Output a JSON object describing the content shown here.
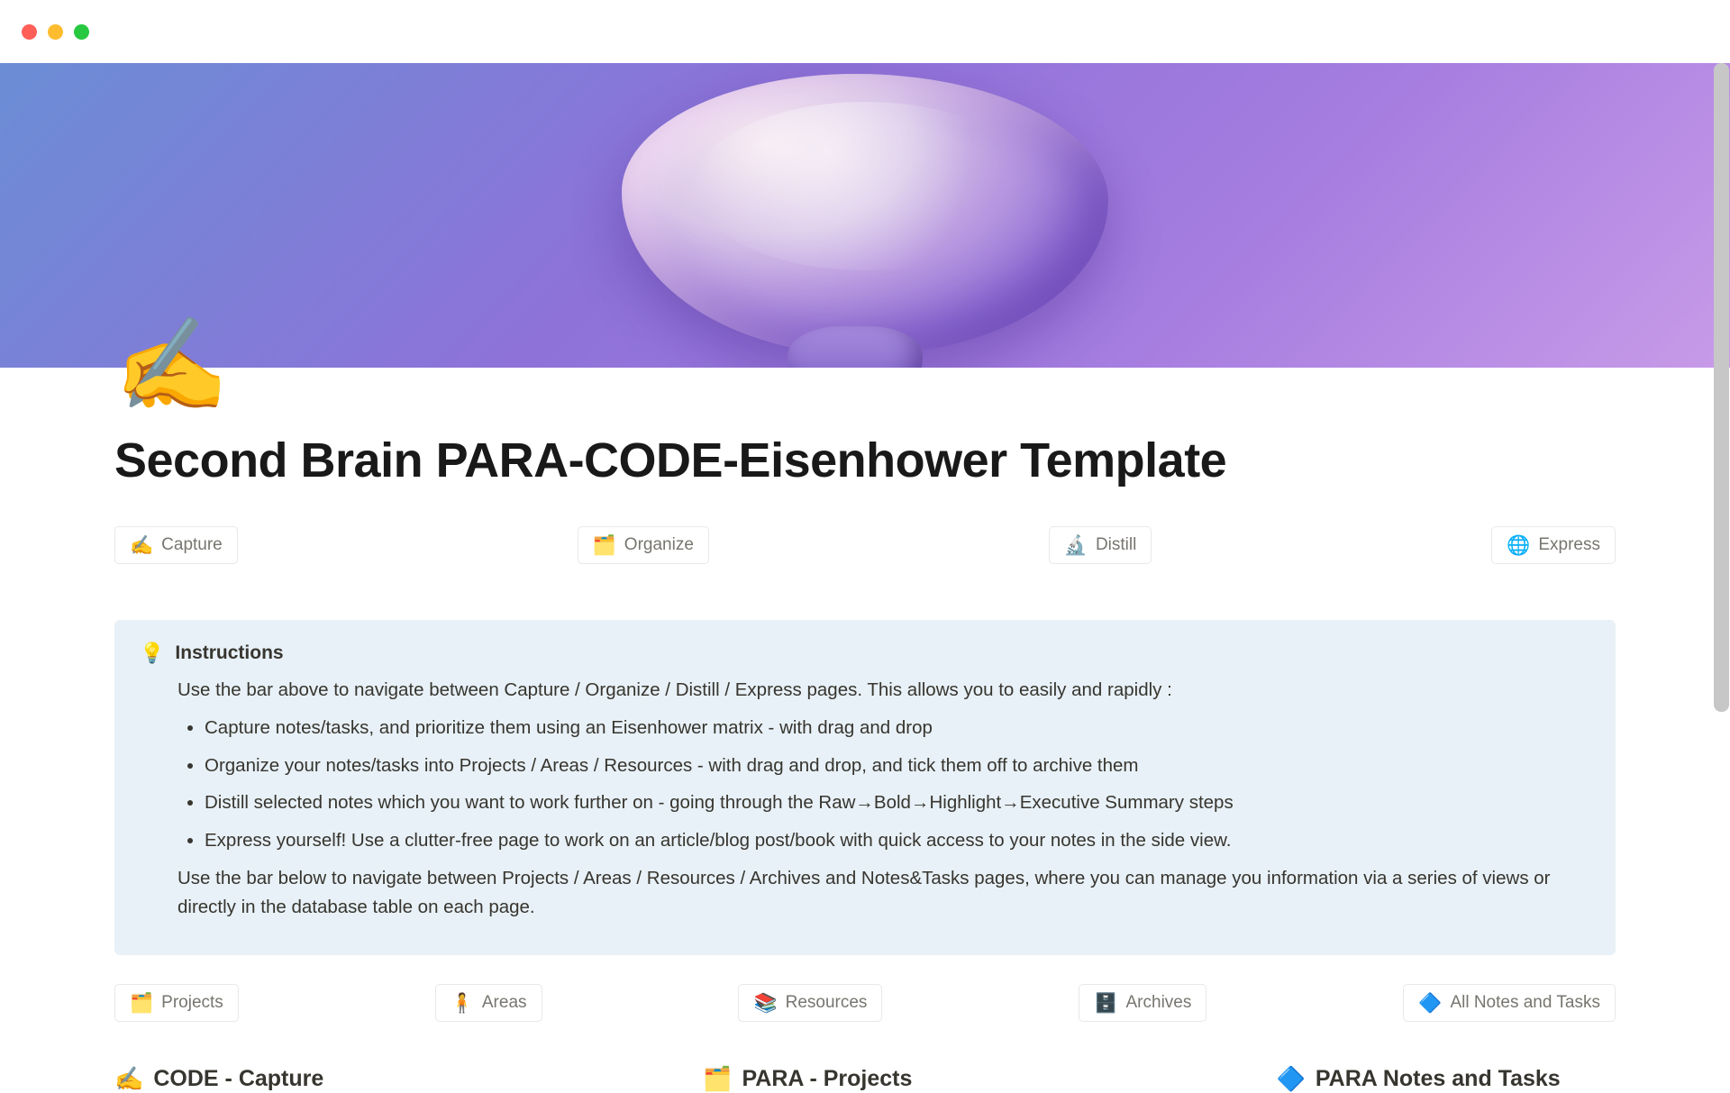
{
  "page": {
    "icon": "✍️",
    "title": "Second Brain PARA-CODE-Eisenhower Template"
  },
  "topNav": [
    {
      "emoji": "✍️",
      "label": "Capture"
    },
    {
      "emoji": "🗂️",
      "label": "Organize"
    },
    {
      "emoji": "🔬",
      "label": "Distill"
    },
    {
      "emoji": "🌐",
      "label": "Express"
    }
  ],
  "instructions": {
    "icon": "💡",
    "title": "Instructions",
    "lead": "Use the bar above to navigate between Capture / Organize / Distill / Express pages. This allows you to easily and rapidly :",
    "bullets": [
      "Capture notes/tasks, and prioritize them using an Eisenhower matrix - with drag and drop",
      "Organize your notes/tasks into Projects / Areas / Resources - with drag and drop, and tick them off to archive them",
      "Distill selected notes which you want to work further on - going through the Raw→Bold→Highlight→Executive Summary steps",
      "Express yourself! Use a clutter-free page to work on an article/blog post/book with quick access to your notes in the side view."
    ],
    "tail": "Use the bar below to navigate between Projects / Areas / Resources / Archives and Notes&Tasks pages, where you can manage you information via a series of views or directly in the database table on each page."
  },
  "bottomNav": [
    {
      "emoji": "🗂️",
      "label": "Projects"
    },
    {
      "emoji": "🧍",
      "label": "Areas"
    },
    {
      "emoji": "📚",
      "label": "Resources"
    },
    {
      "emoji": "🗄️",
      "label": "Archives"
    },
    {
      "emoji": "🔷",
      "label": "All Notes and Tasks"
    }
  ],
  "sections": [
    {
      "emoji": "✍️",
      "label": "CODE - Capture"
    },
    {
      "emoji": "🗂️",
      "label": "PARA - Projects"
    },
    {
      "emoji": "🔷",
      "label": "PARA Notes and Tasks"
    }
  ]
}
